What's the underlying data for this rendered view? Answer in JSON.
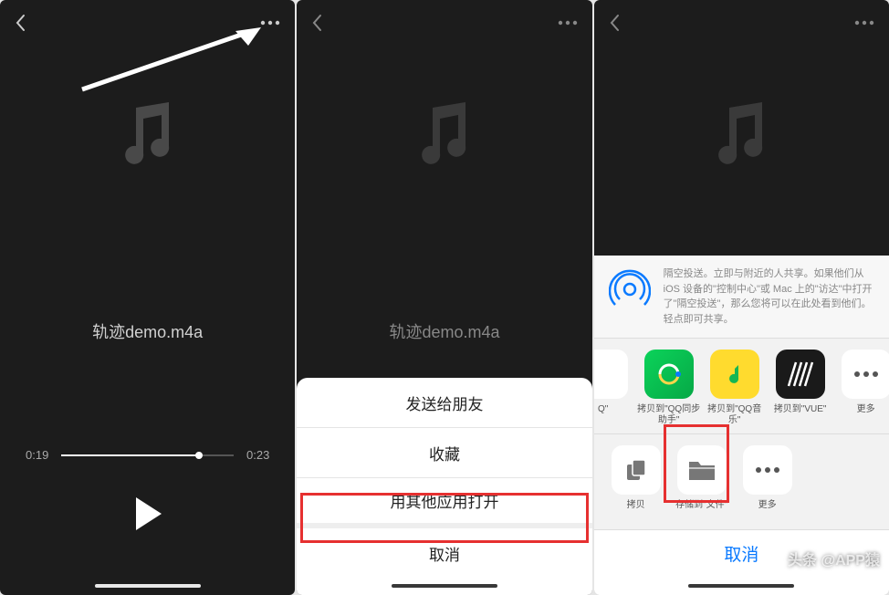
{
  "panel1": {
    "filename": "轨迹demo.m4a",
    "elapsed": "0:19",
    "duration": "0:23"
  },
  "panel2": {
    "filename": "轨迹demo.m4a",
    "menu": {
      "send": "发送给朋友",
      "favorite": "收藏",
      "open_other": "用其他应用打开",
      "cancel": "取消"
    }
  },
  "panel3": {
    "airdrop_text": "隔空投送。立即与附近的人共享。如果他们从 iOS 设备的\"控制中心\"或 Mac 上的\"访达\"中打开了\"隔空投送\"，那么您将可以在此处看到他们。轻点即可共享。",
    "apps": {
      "item0_suffix": "Q\"",
      "qq_sync": "拷贝到\"QQ同步助手\"",
      "qq_music": "拷贝到\"QQ音乐\"",
      "vue": "拷贝到\"VUE\"",
      "more": "更多"
    },
    "actions": {
      "copy": "拷贝",
      "save_files": "存储到\"文件\"",
      "more": "更多"
    },
    "cancel": "取消",
    "watermark": "头条 @APP猿"
  }
}
